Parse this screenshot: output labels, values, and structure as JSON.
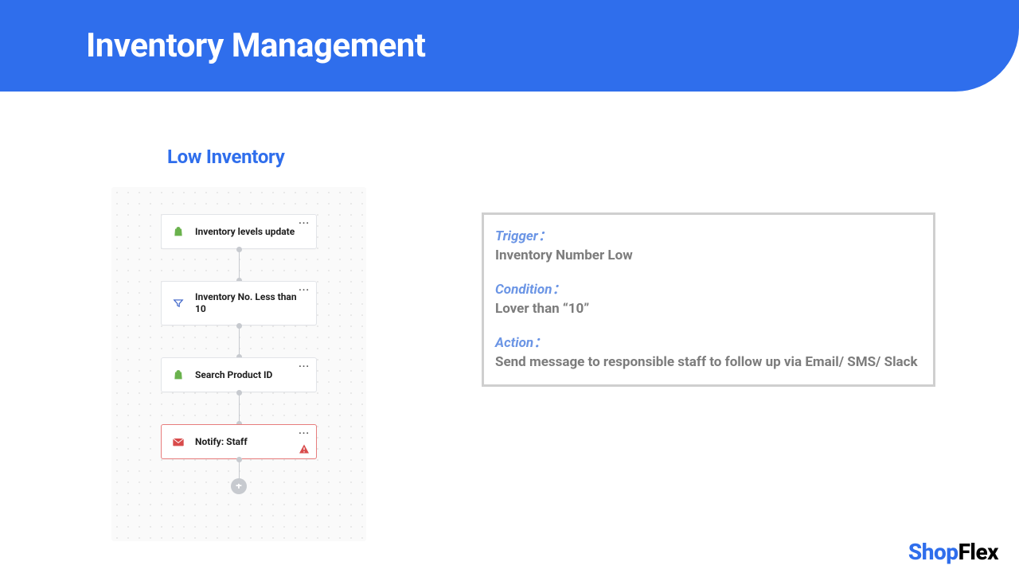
{
  "header": {
    "title": "Inventory Management"
  },
  "section": {
    "title": "Low Inventory"
  },
  "flow": {
    "nodes": [
      {
        "label": "Inventory levels update",
        "icon": "shop-bag-icon",
        "more": "···"
      },
      {
        "label": "Inventory No. Less than 10",
        "icon": "filter-icon",
        "more": "···"
      },
      {
        "label": "Search Product ID",
        "icon": "shop-bag-icon",
        "more": "···"
      },
      {
        "label": "Notify: Staff",
        "icon": "mail-icon",
        "more": "···",
        "error": true
      }
    ],
    "add_label": "+"
  },
  "desc": {
    "trigger_label": "Trigger：",
    "trigger_text": "Inventory Number Low",
    "condition_label": "Condition：",
    "condition_text": "Lover than “10”",
    "action_label": "Action：",
    "action_text": "Send message to responsible staff to follow up via Email/ SMS/ Slack"
  },
  "brand": {
    "part1": "Shop",
    "part2": "Flex"
  }
}
